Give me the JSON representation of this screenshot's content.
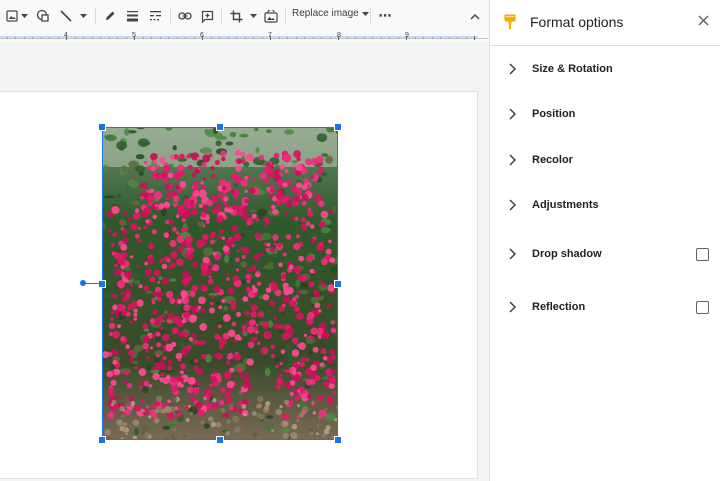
{
  "toolbar": {
    "replace_image_label": "Replace image",
    "more_label": "⋯",
    "icons": [
      "insert-image-icon",
      "dropdown-arrow-icon",
      "shape-icon",
      "line-icon",
      "dropdown-arrow-icon",
      "pen-icon",
      "border-weight-icon",
      "border-dash-icon",
      "link-icon",
      "add-comment-icon",
      "crop-icon",
      "dropdown-arrow-icon",
      "reset-image-icon",
      "collapse-toolbar-icon"
    ]
  },
  "ruler": {
    "numbers": [
      "4",
      "5",
      "6",
      "7",
      "8",
      "9"
    ]
  },
  "panel": {
    "title": "Format options",
    "sections": [
      {
        "label": "Size & Rotation",
        "has_checkbox": false
      },
      {
        "label": "Position",
        "has_checkbox": false
      },
      {
        "label": "Recolor",
        "has_checkbox": false
      },
      {
        "label": "Adjustments",
        "has_checkbox": false
      },
      {
        "label": "Drop shadow",
        "has_checkbox": true,
        "checked": false
      },
      {
        "label": "Reflection",
        "has_checkbox": true,
        "checked": false
      }
    ]
  },
  "colors": {
    "accent": "#1a73e8",
    "brush": "#f9ab00",
    "flower": "#e6186f"
  }
}
